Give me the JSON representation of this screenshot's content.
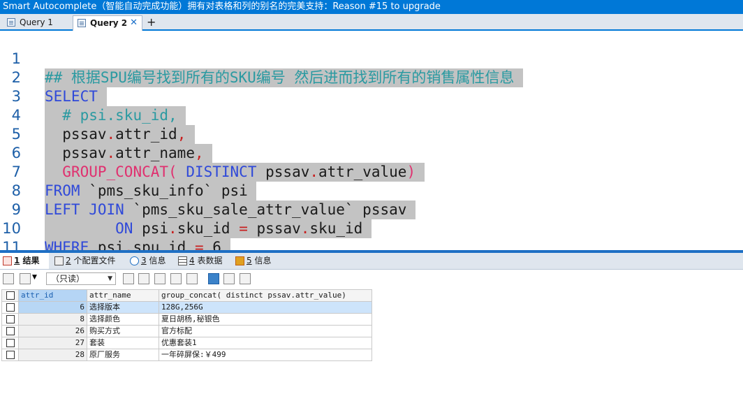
{
  "window": {
    "title": "Smart Autocomplete（智能自动完成功能）拥有对表格和列的别名的完美支持：Reason #15 to upgrade"
  },
  "query_tabs": [
    {
      "label": "Query 1",
      "active": false
    },
    {
      "label": "Query 2",
      "active": true
    }
  ],
  "add_tab_label": "+",
  "close_label": "✕",
  "editor": {
    "line_numbers": [
      "1",
      "2",
      "3",
      "4",
      "5",
      "6",
      "7",
      "8",
      "9",
      "10",
      "11"
    ]
  },
  "results": {
    "tabs": [
      {
        "num": "1",
        "label": " 结果",
        "active": true
      },
      {
        "num": "2",
        "label": " 个配置文件"
      },
      {
        "num": "3",
        "label": " 信息"
      },
      {
        "num": "4",
        "label": " 表数据"
      },
      {
        "num": "5",
        "label": " 信息"
      }
    ],
    "readonly_label": "（只读）",
    "columns": [
      "attr_id",
      "attr_name",
      "group_concat( distinct pssav.attr_value)"
    ],
    "rows": [
      {
        "attr_id": "6",
        "attr_name": "选择版本",
        "value": "128G,256G"
      },
      {
        "attr_id": "8",
        "attr_name": "选择颜色",
        "value": "夏日胡杨,秘银色"
      },
      {
        "attr_id": "26",
        "attr_name": "购买方式",
        "value": "官方标配"
      },
      {
        "attr_id": "27",
        "attr_name": "套装",
        "value": "优惠套装1"
      },
      {
        "attr_id": "28",
        "attr_name": "原厂服务",
        "value": "一年碎屏保:￥499"
      }
    ]
  },
  "colors": {
    "accent": "#0078d7",
    "keyword": "#2f49d9",
    "function": "#e0306f",
    "comment": "#2a9aa1",
    "operator": "#c81f1f",
    "selection": "#c3c3c3"
  }
}
